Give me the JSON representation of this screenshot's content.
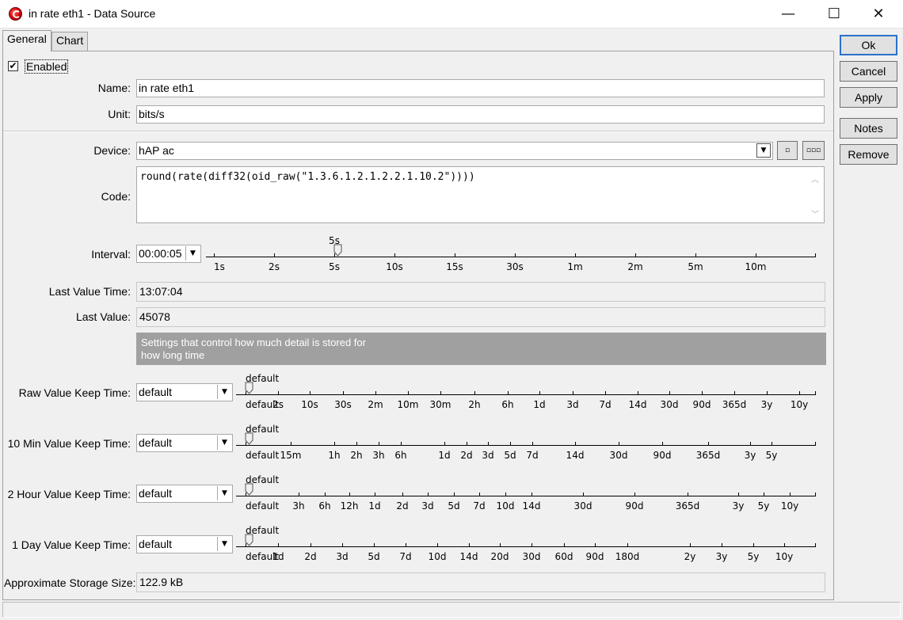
{
  "window": {
    "title": "in rate eth1 - Data Source",
    "minimize_glyph": "—",
    "maximize_glyph": "☐",
    "close_glyph": "✕",
    "icon": "app-logo-icon"
  },
  "tabs": [
    {
      "label": "General",
      "active": true
    },
    {
      "label": "Chart",
      "active": false
    }
  ],
  "side_buttons": {
    "ok": "Ok",
    "cancel": "Cancel",
    "apply": "Apply",
    "notes": "Notes",
    "remove": "Remove"
  },
  "general": {
    "enabled": {
      "label": "Enabled",
      "checked": true
    },
    "name": {
      "label": "Name:",
      "value": "in rate eth1"
    },
    "unit": {
      "label": "Unit:",
      "value": "bits/s"
    },
    "device": {
      "label": "Device:",
      "value": "hAP ac",
      "small_btn": "▫",
      "more_btn": "▫▫▫"
    },
    "code": {
      "label": "Code:",
      "value": "round(rate(diff32(oid_raw(\"1.3.6.1.2.1.2.2.1.10.2\"))))"
    },
    "interval": {
      "label": "Interval:",
      "value": "00:00:05",
      "slider": {
        "ticks": [
          "1s",
          "2s",
          "5s",
          "10s",
          "15s",
          "30s",
          "1m",
          "2m",
          "5m",
          "10m"
        ],
        "current": "5s"
      }
    },
    "last_value_time": {
      "label": "Last Value Time:",
      "value": "13:07:04"
    },
    "last_value": {
      "label": "Last Value:",
      "value": "45078"
    },
    "info": {
      "line1": "Settings that control how much detail is stored for",
      "line2": "how long time"
    },
    "keep_times": [
      {
        "label": "Raw Value Keep Time:",
        "value": "default",
        "current": "default",
        "ticks": [
          "default",
          "2s",
          "10s",
          "30s",
          "2m",
          "10m",
          "30m",
          "2h",
          "6h",
          "1d",
          "3d",
          "7d",
          "14d",
          "30d",
          "90d",
          "365d",
          "3y",
          "10y"
        ]
      },
      {
        "label": "10 Min Value Keep Time:",
        "value": "default",
        "current": "default",
        "ticks": [
          "default",
          "15m",
          "1h",
          "2h",
          "3h",
          "6h",
          "1d",
          "2d",
          "3d",
          "5d",
          "7d",
          "14d",
          "30d",
          "90d",
          "365d",
          "3y",
          "5y"
        ]
      },
      {
        "label": "2 Hour Value Keep Time:",
        "value": "default",
        "current": "default",
        "ticks": [
          "default",
          "3h",
          "6h",
          "12h",
          "1d",
          "2d",
          "3d",
          "5d",
          "7d",
          "10d",
          "14d",
          "30d",
          "90d",
          "365d",
          "3y",
          "5y",
          "10y"
        ]
      },
      {
        "label": "1 Day Value Keep Time:",
        "value": "default",
        "current": "default",
        "ticks": [
          "default",
          "1d",
          "2d",
          "3d",
          "5d",
          "7d",
          "10d",
          "14d",
          "20d",
          "30d",
          "60d",
          "90d",
          "180d",
          "2y",
          "3y",
          "5y",
          "10y"
        ]
      }
    ],
    "storage": {
      "label": "Approximate Storage Size:",
      "value": "122.9 kB"
    }
  }
}
